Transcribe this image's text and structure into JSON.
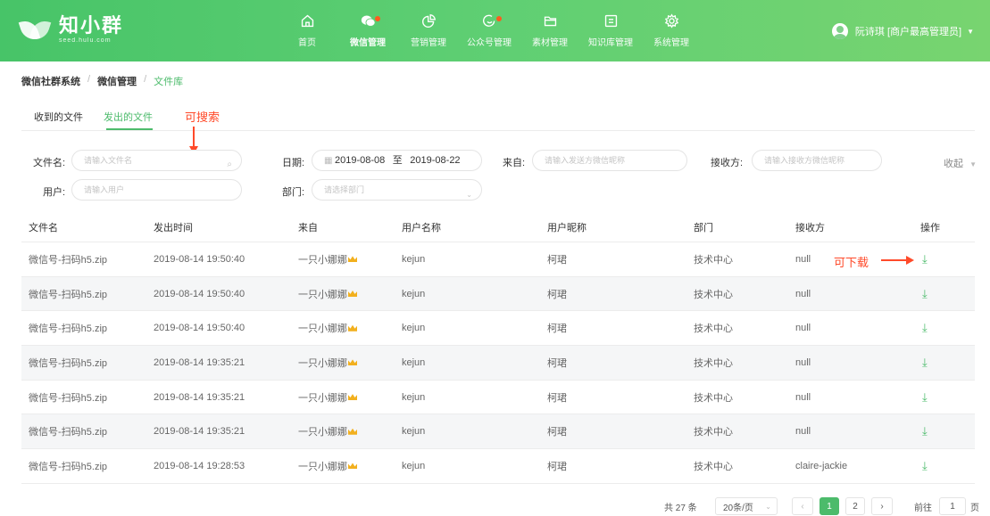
{
  "header": {
    "logo_title": "知小群",
    "logo_sub": "seed.hulu.com",
    "nav": [
      {
        "label": "首页",
        "icon": "home-icon"
      },
      {
        "label": "微信管理",
        "icon": "wechat-icon"
      },
      {
        "label": "营销管理",
        "icon": "pie-chart-icon"
      },
      {
        "label": "公众号管理",
        "icon": "chat-bubble-icon"
      },
      {
        "label": "素材管理",
        "icon": "folder-icon"
      },
      {
        "label": "知识库管理",
        "icon": "book-icon"
      },
      {
        "label": "系统管理",
        "icon": "gear-icon"
      }
    ],
    "user": "阮诗琪 [商户最高管理员]"
  },
  "breadcrumb": [
    "微信社群系统",
    "微信管理",
    "文件库"
  ],
  "tabs": [
    "收到的文件",
    "发出的文件"
  ],
  "annotations": {
    "search": "可搜索",
    "download": "可下载"
  },
  "filters": {
    "filename_label": "文件名:",
    "filename_placeholder": "请输入文件名",
    "date_label": "日期:",
    "date_start": "2019-08-08",
    "date_sep": "至",
    "date_end": "2019-08-22",
    "from_label": "来自:",
    "from_placeholder": "请输入发送方微信昵称",
    "receiver_label": "接收方:",
    "receiver_placeholder": "请输入接收方微信昵称",
    "collapse_label": "收起",
    "user_label": "用户:",
    "user_placeholder": "请输入用户",
    "dept_label": "部门:",
    "dept_placeholder": "请选择部门"
  },
  "table": {
    "headers": [
      "文件名",
      "发出时间",
      "来自",
      "用户名称",
      "用户昵称",
      "部门",
      "接收方",
      "操作"
    ],
    "rows": [
      [
        "微信号-扫码h5.zip",
        "2019-08-14 19:50:40",
        "一只小娜娜",
        "kejun",
        "柯珺",
        "技术中心",
        "null"
      ],
      [
        "微信号-扫码h5.zip",
        "2019-08-14 19:50:40",
        "一只小娜娜",
        "kejun",
        "柯珺",
        "技术中心",
        "null"
      ],
      [
        "微信号-扫码h5.zip",
        "2019-08-14 19:50:40",
        "一只小娜娜",
        "kejun",
        "柯珺",
        "技术中心",
        "null"
      ],
      [
        "微信号-扫码h5.zip",
        "2019-08-14 19:35:21",
        "一只小娜娜",
        "kejun",
        "柯珺",
        "技术中心",
        "null"
      ],
      [
        "微信号-扫码h5.zip",
        "2019-08-14 19:35:21",
        "一只小娜娜",
        "kejun",
        "柯珺",
        "技术中心",
        "null"
      ],
      [
        "微信号-扫码h5.zip",
        "2019-08-14 19:35:21",
        "一只小娜娜",
        "kejun",
        "柯珺",
        "技术中心",
        "null"
      ],
      [
        "微信号-扫码h5.zip",
        "2019-08-14 19:28:53",
        "一只小娜娜",
        "kejun",
        "柯珺",
        "技术中心",
        "claire-jackie"
      ]
    ]
  },
  "pagination": {
    "total": "共 27 条",
    "page_size": "20条/页",
    "pages": [
      "1",
      "2"
    ],
    "goto_label": "前往",
    "goto_value": "1",
    "page_unit": "页"
  },
  "colors": {
    "primary": "#4cbb6b",
    "annotation": "#ff4a2a"
  }
}
